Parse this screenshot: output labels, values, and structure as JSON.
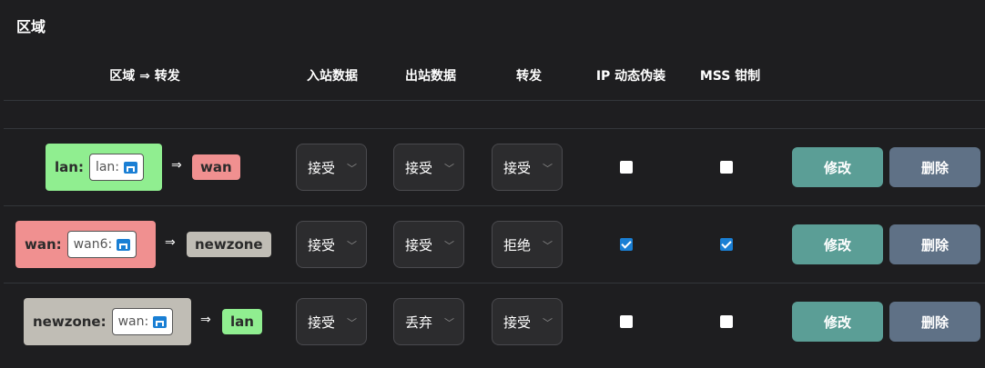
{
  "title": "区域",
  "headers": {
    "zone_forward": "区域 ⇒ 转发",
    "input": "入站数据",
    "output": "出站数据",
    "forward": "转发",
    "masq": "IP 动态伪装",
    "mss": "MSS 钳制"
  },
  "colors": {
    "lan": "#90ee90",
    "wan": "#f09090",
    "newzone": "#c0bdb5",
    "edit_button": "#5b9e96",
    "delete_button": "#5f7186",
    "checkbox_checked": "#1a7fd4"
  },
  "rows": [
    {
      "zone_label": "lan:",
      "iface": "lan:",
      "iface_icon": "network-port-icon",
      "arrow": "⇒",
      "dest": "wan",
      "input": "接受",
      "output": "接受",
      "forward": "接受",
      "masq": false,
      "mss": false,
      "edit": "修改",
      "delete": "删除"
    },
    {
      "zone_label": "wan:",
      "iface": "wan6:",
      "iface_icon": "network-port-icon",
      "arrow": "⇒",
      "dest": "newzone",
      "input": "接受",
      "output": "接受",
      "forward": "拒绝",
      "masq": true,
      "mss": true,
      "edit": "修改",
      "delete": "删除"
    },
    {
      "zone_label": "newzone:",
      "iface": "wan:",
      "iface_icon": "network-port-icon",
      "arrow": "⇒",
      "dest": "lan",
      "input": "接受",
      "output": "丢弃",
      "forward": "接受",
      "masq": false,
      "mss": false,
      "edit": "修改",
      "delete": "删除"
    }
  ]
}
